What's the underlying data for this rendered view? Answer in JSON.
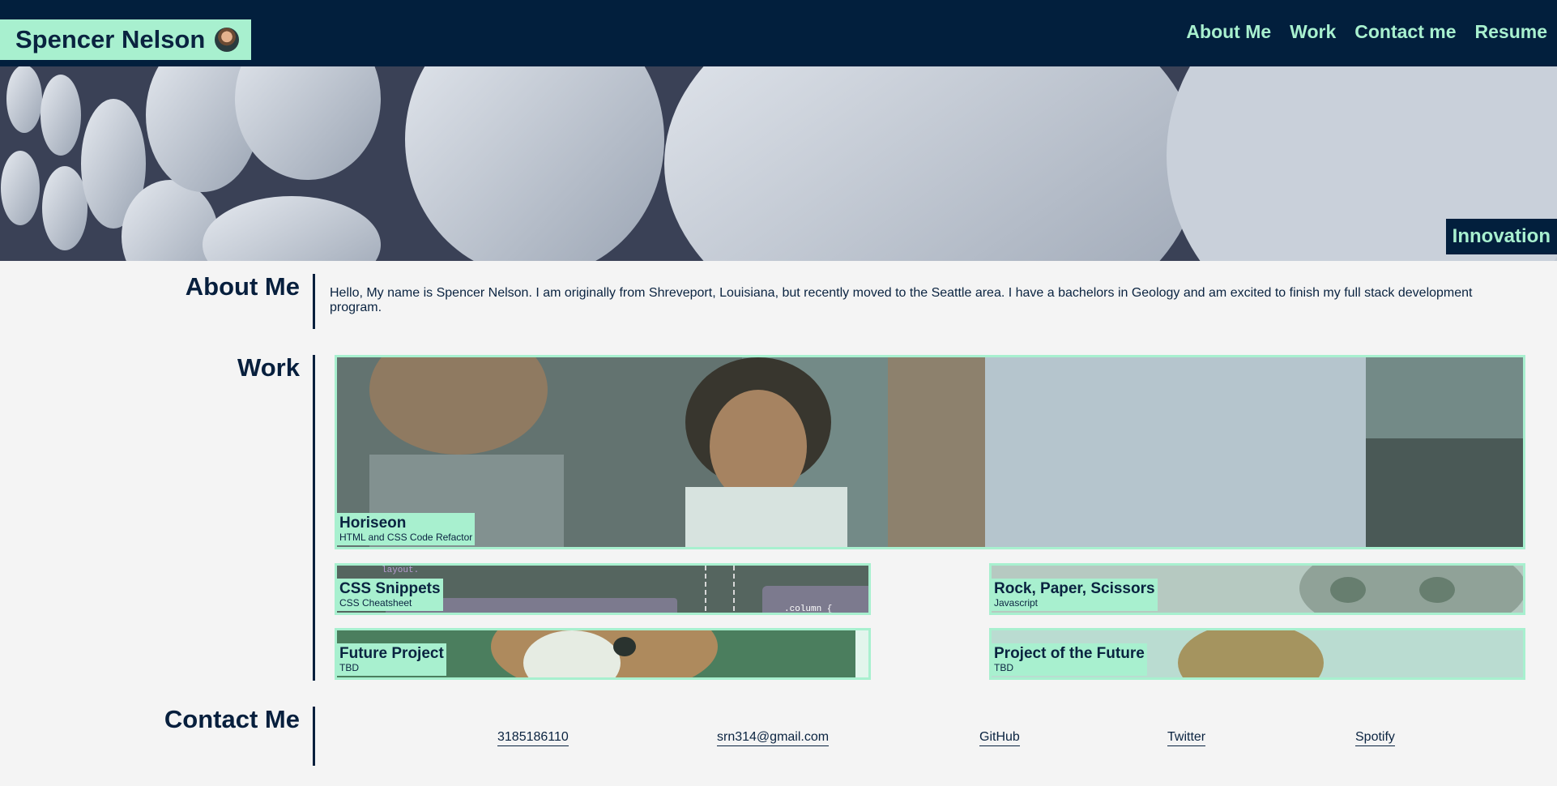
{
  "header": {
    "brand_name": "Spencer Nelson",
    "nav": [
      "About Me",
      "Work",
      "Contact me",
      "Resume"
    ]
  },
  "hero": {
    "tag": "Innovation"
  },
  "about": {
    "title": "About Me",
    "text": "Hello, My name is Spencer Nelson. I am originally from Shreveport, Louisiana, but recently moved to the Seattle area. I have a bachelors in Geology and am excited to finish my full stack development program."
  },
  "work": {
    "title": "Work",
    "projects": [
      {
        "title": "Horiseon",
        "subtitle": "HTML and CSS Code Refactor"
      },
      {
        "title": "CSS Snippets",
        "subtitle": "CSS Cheatsheet"
      },
      {
        "title": "Rock, Paper, Scissors",
        "subtitle": "Javascript"
      },
      {
        "title": "Future Project",
        "subtitle": "TBD"
      },
      {
        "title": "Project of the Future",
        "subtitle": "TBD"
      }
    ],
    "snippet_code": ".column {",
    "snippet_word": "layout."
  },
  "contact": {
    "title": "Contact Me",
    "links": [
      "3185186110",
      "srn314@gmail.com",
      "GitHub",
      "Twitter",
      "Spotify"
    ]
  },
  "colors": {
    "navy": "#021f3d",
    "mint": "#a8f0cf",
    "background": "#f4f4f4"
  }
}
